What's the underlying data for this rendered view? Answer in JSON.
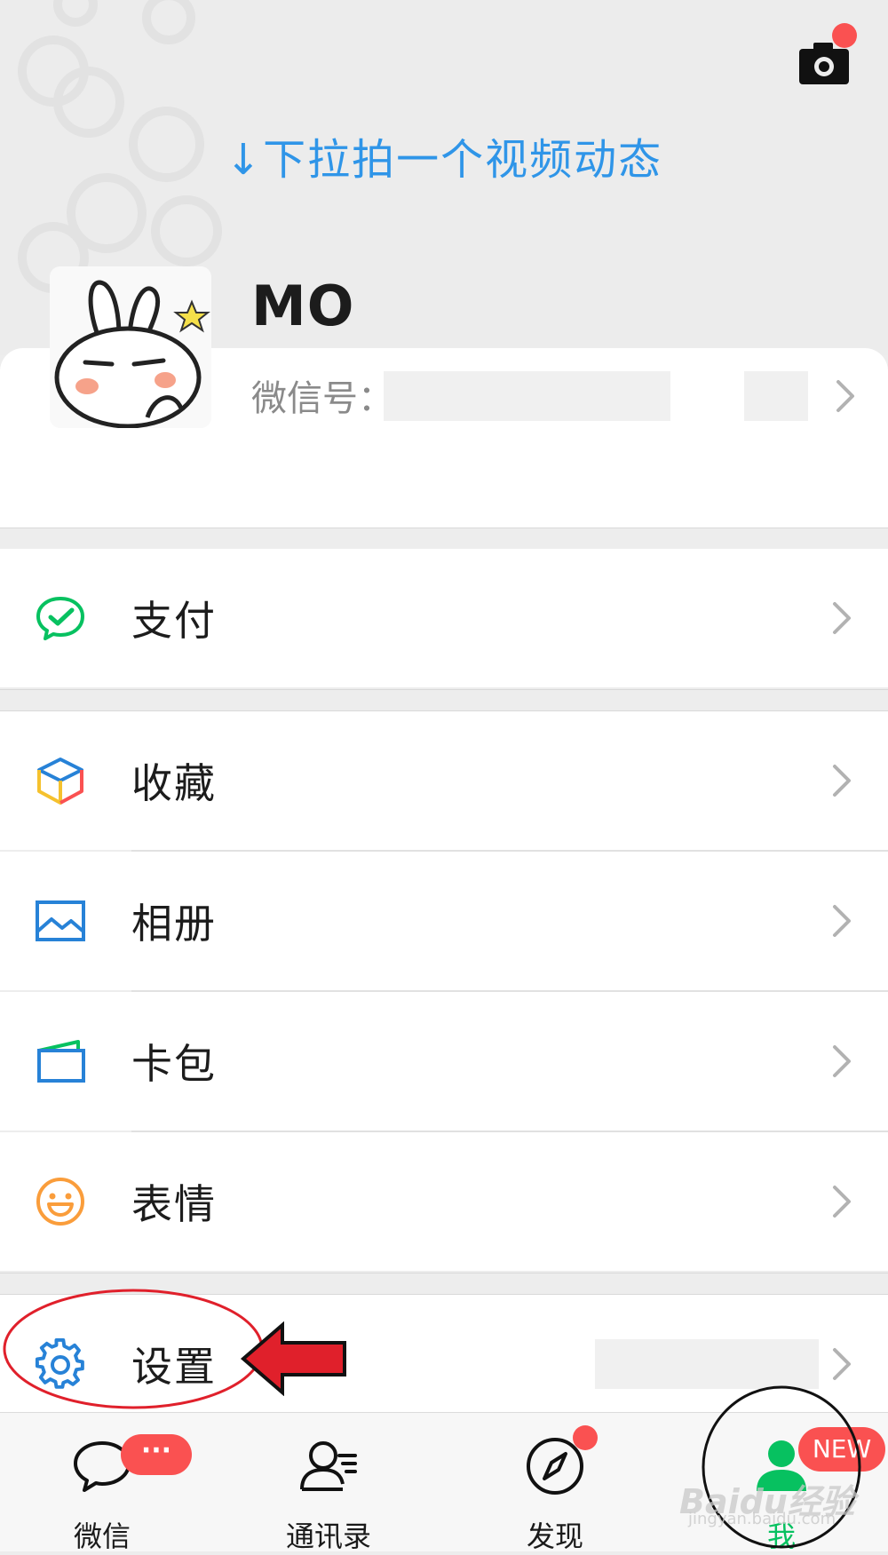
{
  "header": {
    "pull_hint": "↓下拉拍一个视频动态",
    "camera_icon": "camera-icon"
  },
  "profile": {
    "name": "MO",
    "wechat_id_label": "微信号：",
    "avatar": "cartoon-rabbit-avatar"
  },
  "menu": {
    "pay": {
      "label": "支付",
      "icon": "wechat-pay-icon",
      "color": "#07c160"
    },
    "favorites": {
      "label": "收藏",
      "icon": "cube-icon"
    },
    "album": {
      "label": "相册",
      "icon": "picture-icon",
      "color": "#2782d7"
    },
    "cards": {
      "label": "卡包",
      "icon": "wallet-icon",
      "color": "#2782d7"
    },
    "stickers": {
      "label": "表情",
      "icon": "smiley-icon",
      "color": "#fa9d3b"
    },
    "settings": {
      "label": "设置",
      "icon": "gear-icon",
      "color": "#2782d7"
    }
  },
  "tabbar": {
    "chats": {
      "label": "微信",
      "badge": "···"
    },
    "contacts": {
      "label": "通讯录"
    },
    "discover": {
      "label": "发现"
    },
    "me": {
      "label": "我",
      "badge": "NEW",
      "color": "#07c160"
    }
  },
  "watermark": {
    "text": "Baidu经验",
    "sub": "jingyan.baidu.com"
  },
  "colors": {
    "accent_green": "#07c160",
    "badge_red": "#fa5151",
    "hint_blue": "#2f95e8"
  }
}
